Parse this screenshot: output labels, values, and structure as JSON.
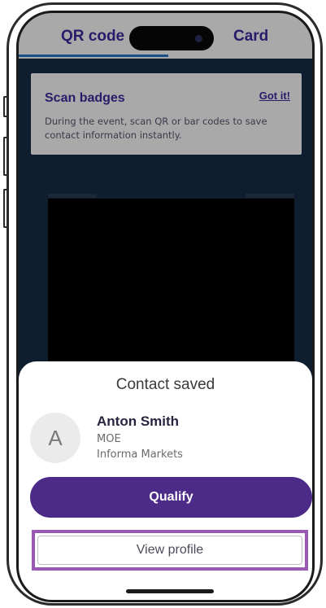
{
  "tabs": {
    "qr_label": "QR code",
    "card_label": "Card"
  },
  "banner": {
    "title": "Scan badges",
    "dismiss": "Got it!",
    "description": "During the event, scan QR or bar codes to save contact information instantly."
  },
  "sheet": {
    "title": "Contact saved",
    "avatar_initial": "A",
    "contact": {
      "name": "Anton Smith",
      "role": "MOE",
      "company": "Informa Markets"
    },
    "primary_action": "Qualify",
    "secondary_action": "View profile"
  },
  "colors": {
    "accent": "#4b2a88",
    "highlight": "#9b59b6",
    "banner": "#a9a9a9"
  }
}
